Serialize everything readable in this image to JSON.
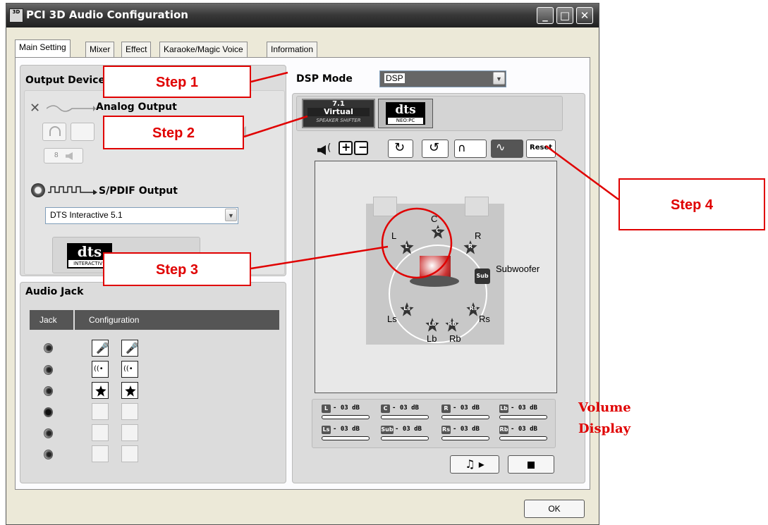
{
  "window": {
    "title": "PCI 3D Audio Configuration",
    "icon_text": "3D",
    "controls": {
      "minimize": "_",
      "maximize": "□",
      "close": "✕"
    }
  },
  "tabs": [
    "Main Setting",
    "Mixer",
    "Effect",
    "Karaoke/Magic Voice",
    "Information"
  ],
  "active_tab": "Main Setting",
  "output_device": {
    "heading": "Output Device",
    "analog_label": "Analog Output",
    "analog_8ch_label": "8",
    "spdif_label": "S/PDIF Output",
    "spdif_select": "DTS Interactive 5.1",
    "dts_logo": "dts",
    "dts_sub": "INTERACTIVE"
  },
  "dsp": {
    "label": "DSP Mode",
    "value": "DSP",
    "virtual_top": "7.1",
    "virtual_mid": "Virtual",
    "virtual_bot": "SPEAKER SHIFTER",
    "dts_logo": "dts",
    "dts_sub": "NEO:PC"
  },
  "toolbar": {
    "reset_label": "Reset"
  },
  "speakers": {
    "labels": {
      "C": "C",
      "L": "L",
      "R": "R",
      "Ls": "Ls",
      "Rs": "Rs",
      "Lb": "Lb",
      "Rb": "Rb",
      "Sub": "Subwoofer"
    },
    "badges": {
      "C": "C",
      "L": "L",
      "R": "R",
      "Ls": "Ls",
      "Rs": "Rs",
      "Lb": "Lb",
      "Rb": "Rb",
      "Sub": "Sub"
    }
  },
  "volume": [
    {
      "badge": "L",
      "text": "- 03 dB"
    },
    {
      "badge": "C",
      "text": "- 03 dB"
    },
    {
      "badge": "R",
      "text": "- 03 dB"
    },
    {
      "badge": "Lb",
      "text": "- 03 dB"
    },
    {
      "badge": "Ls",
      "text": "- 03 dB"
    },
    {
      "badge": "Sub",
      "text": "- 03 dB"
    },
    {
      "badge": "Rs",
      "text": "- 03 dB"
    },
    {
      "badge": "Rb",
      "text": "- 03 dB"
    }
  ],
  "audio_jack": {
    "heading": "Audio Jack",
    "col_jack": "Jack",
    "col_config": "Configuration"
  },
  "ok_label": "OK",
  "annotations": {
    "step1": "Step 1",
    "step2": "Step 2",
    "step3": "Step 3",
    "step4": "Step 4",
    "volume_display_1": "Volume",
    "volume_display_2": "Display"
  },
  "colors": {
    "annotation_red": "#e00000",
    "title_bar": "#3a3a3a",
    "panel_bg": "#dcdcdc"
  }
}
